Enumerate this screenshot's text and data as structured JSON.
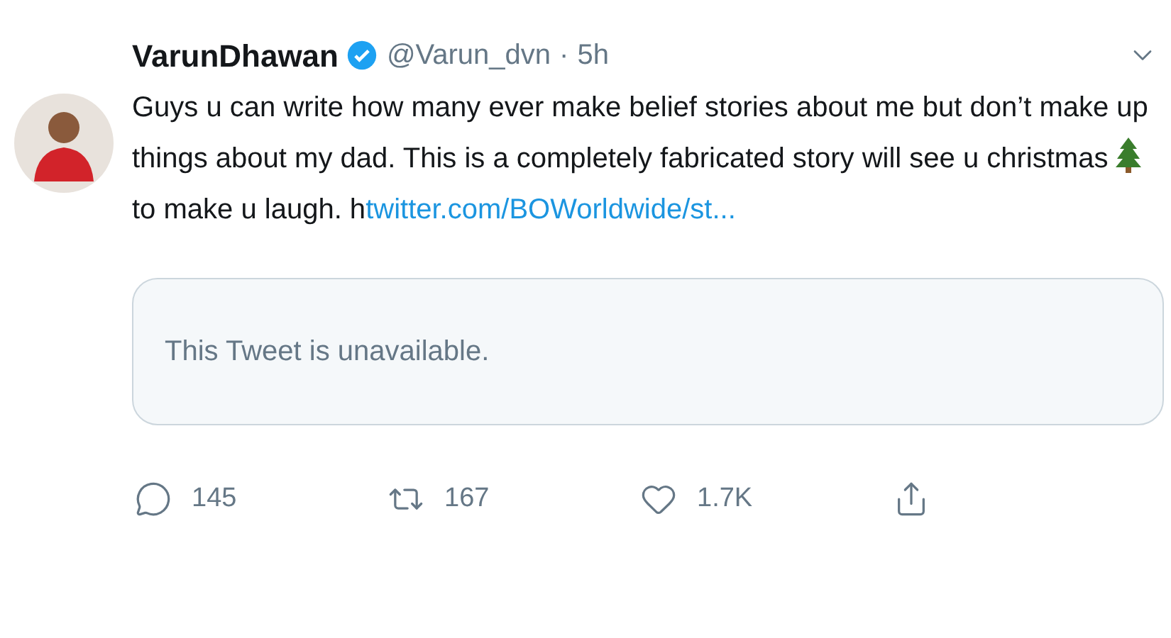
{
  "author": {
    "name": "VarunDhawan",
    "verified": true,
    "handle": "@Varun_dvn",
    "separator": "·",
    "time": "5h"
  },
  "text": {
    "before_icon": "Guys u can write how many ever make belief stories about me but don’t make up things about my dad. This is a completely fabricated story will see u christmas",
    "after_icon": "to make u laugh. h",
    "link": "twitter.com/BOWorldwide/st..."
  },
  "quoted": {
    "message": "This Tweet is unavailable."
  },
  "actions": [
    {
      "kind": "reply",
      "count": "145"
    },
    {
      "kind": "retweet",
      "count": "167"
    },
    {
      "kind": "like",
      "count": "1.7K"
    },
    {
      "kind": "share"
    }
  ]
}
